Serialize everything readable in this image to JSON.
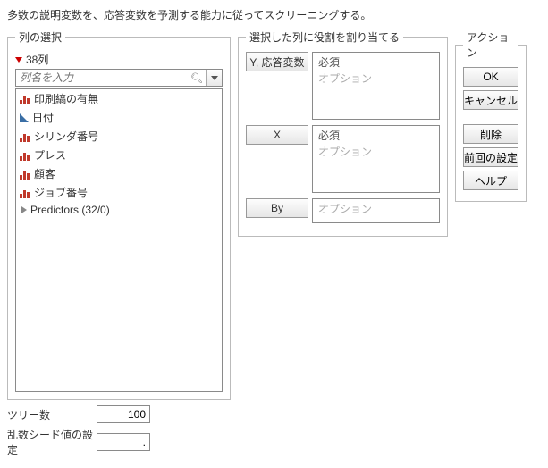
{
  "description": "多数の説明変数を、応答変数を予測する能力に従ってスクリーニングする。",
  "column_select": {
    "legend": "列の選択",
    "count": "38列",
    "filter_placeholder": "列名を入力",
    "items": [
      {
        "type": "nominal",
        "label": "印刷縞の有無"
      },
      {
        "type": "continuous",
        "label": "日付"
      },
      {
        "type": "nominal",
        "label": "シリンダ番号"
      },
      {
        "type": "nominal",
        "label": "プレス"
      },
      {
        "type": "nominal",
        "label": "顧客"
      },
      {
        "type": "nominal",
        "label": "ジョブ番号"
      },
      {
        "type": "group",
        "label": "Predictors (32/0)"
      }
    ]
  },
  "roles": {
    "legend": "選択した列に役割を割り当てる",
    "y_label": "Y, 応答変数",
    "x_label": "X",
    "by_label": "By",
    "required": "必須",
    "optional": "オプション"
  },
  "actions": {
    "legend": "アクション",
    "ok": "OK",
    "cancel": "キャンセル",
    "remove": "削除",
    "recall": "前回の設定",
    "help": "ヘルプ"
  },
  "params": {
    "trees_label": "ツリー数",
    "trees_value": "100",
    "seed_label": "乱数シード値の設定",
    "seed_value": "."
  }
}
